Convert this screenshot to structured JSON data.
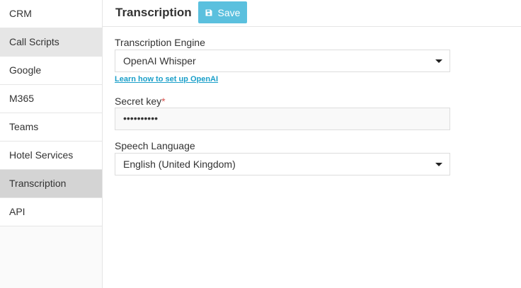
{
  "sidebar": {
    "items": [
      {
        "label": "CRM"
      },
      {
        "label": "Call Scripts"
      },
      {
        "label": "Google"
      },
      {
        "label": "M365"
      },
      {
        "label": "Teams"
      },
      {
        "label": "Hotel Services"
      },
      {
        "label": "Transcription"
      },
      {
        "label": "API"
      }
    ]
  },
  "header": {
    "title": "Transcription",
    "save_label": "Save",
    "save_icon": "floppy-disk-icon"
  },
  "form": {
    "engine": {
      "label": "Transcription Engine",
      "value": "OpenAI Whisper",
      "help_link": "Learn how to set up OpenAI"
    },
    "secret": {
      "label": "Secret key",
      "required_mark": "*",
      "value": "••••••••••"
    },
    "language": {
      "label": "Speech Language",
      "value": "English (United Kingdom)"
    }
  },
  "colors": {
    "save_button": "#5bc0de",
    "link": "#1a9fc9",
    "required": "#d9534f",
    "active_sidebar": "#d4d4d4",
    "hover_sidebar": "#e6e6e6"
  }
}
